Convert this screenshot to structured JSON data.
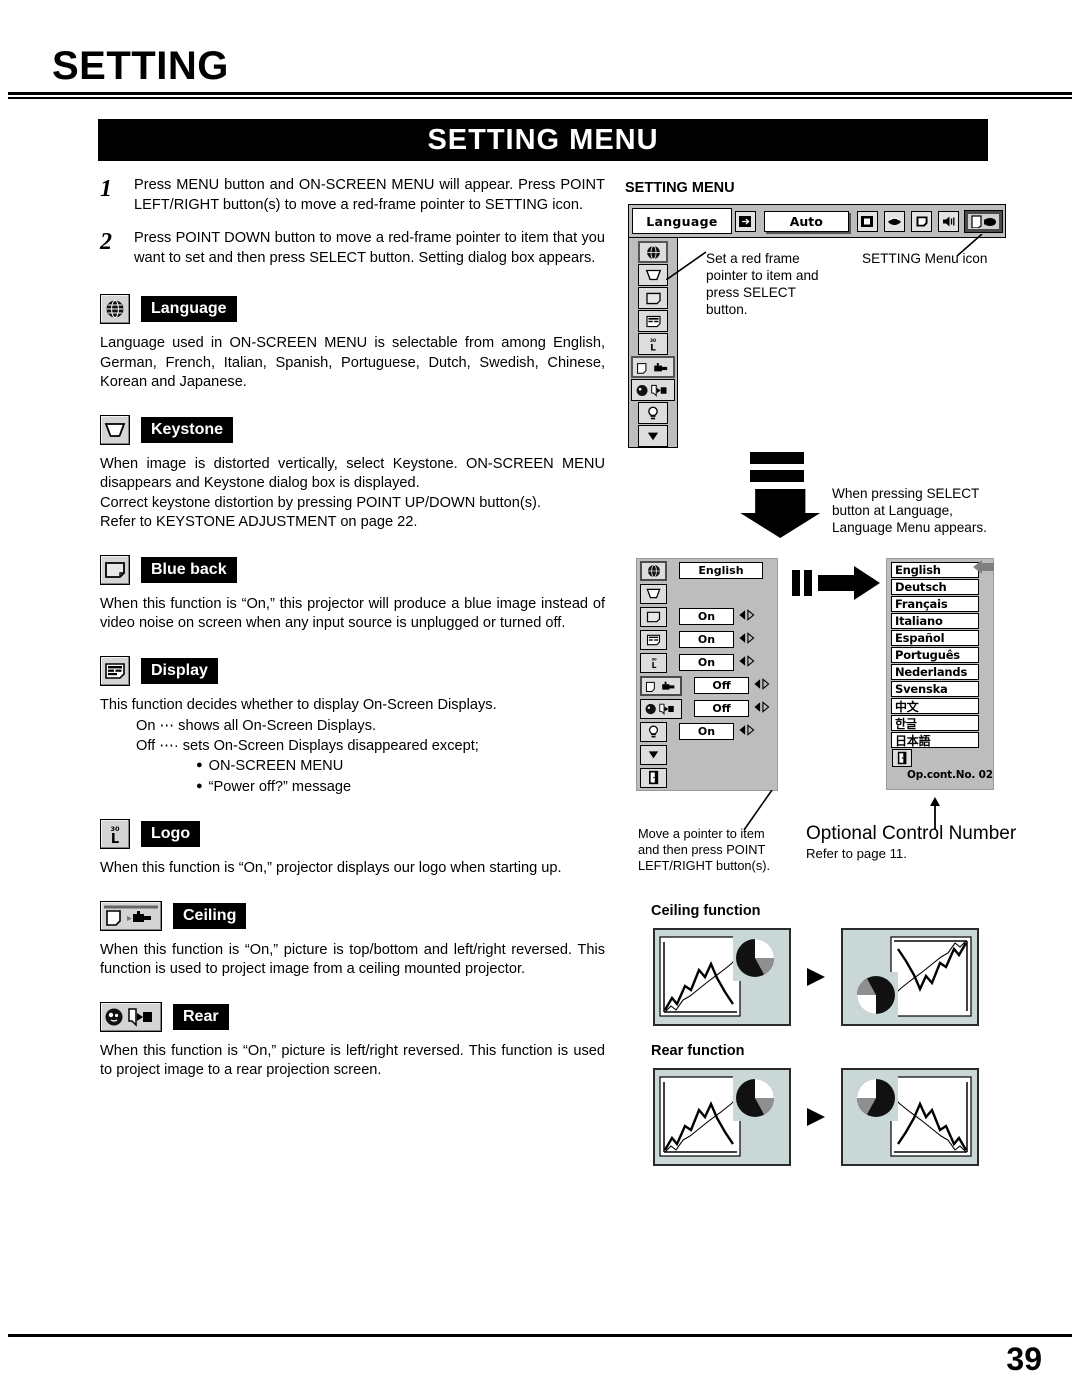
{
  "header": {
    "chapter_title": "SETTING",
    "banner_title": "SETTING MENU"
  },
  "steps": [
    {
      "num": "1",
      "text": "Press MENU button and ON-SCREEN MENU will appear.  Press POINT LEFT/RIGHT button(s) to move a red-frame pointer to SETTING icon."
    },
    {
      "num": "2",
      "text": "Press POINT DOWN button to move a red-frame pointer to item that you want to set and then press SELECT button.  Setting dialog box appears."
    }
  ],
  "sections": [
    {
      "icon": "globe-icon",
      "label": "Language",
      "body": "Language used in ON-SCREEN MENU is selectable from among English, German, French, Italian, Spanish, Portuguese, Dutch, Swedish, Chinese, Korean and Japanese."
    },
    {
      "icon": "keystone-icon",
      "label": "Keystone",
      "body": "When image is distorted vertically, select Keystone.  ON-SCREEN MENU disappears and Keystone dialog box is displayed.",
      "body2": "Correct keystone distortion by pressing POINT UP/DOWN button(s).",
      "body3": "Refer to KEYSTONE ADJUSTMENT on page 22."
    },
    {
      "icon": "blue-back-icon",
      "label": "Blue back",
      "body": "When this function is “On,” this projector will produce a blue image instead of video noise on screen when any input source is unplugged or turned off."
    },
    {
      "icon": "display-icon",
      "label": "Display",
      "body": "This function decides whether to display On-Screen Displays.",
      "list": [
        "On  ⋯ shows all On-Screen Displays.",
        "Off ⋯· sets On-Screen Displays disappeared except;"
      ],
      "sublist": [
        "ON-SCREEN MENU",
        "“Power off?” message"
      ]
    },
    {
      "icon": "logo-icon",
      "label": "Logo",
      "body": "When this function is “On,” projector displays our logo when starting up."
    },
    {
      "icon": "ceiling-icon",
      "label": "Ceiling",
      "body": "When this function is “On,” picture is top/bottom and left/right reversed. This function is used to project image from a ceiling mounted projector."
    },
    {
      "icon": "rear-icon",
      "label": "Rear",
      "body": "When this function is “On,” picture is left/right reversed.  This function is used to project image to a rear projection screen."
    }
  ],
  "right": {
    "menu_title": "SETTING MENU",
    "osd_bar": {
      "language_tab": "Language",
      "auto_button": "Auto",
      "icons": [
        "input-icon",
        "screen-icon",
        "image-icon",
        "pc-adjust-icon",
        "sound-icon",
        "setting-icon"
      ]
    },
    "callout_red_frame": "Set a red frame\npointer to item and\npress SELECT\nbutton.",
    "callout_red_frame_lines": [
      "Set a red frame",
      "pointer to item and",
      "press SELECT",
      "button."
    ],
    "callout_setting_icon": "SETTING Menu icon",
    "callout_select": [
      "When pressing SELECT",
      "button at Language,",
      "Language Menu appears."
    ],
    "dialog": {
      "rows": [
        {
          "icon": "globe-icon",
          "value": "English",
          "wide": true,
          "arrows": false,
          "selected": true
        },
        {
          "icon": "keystone-icon",
          "value": "",
          "arrows": false
        },
        {
          "icon": "blue-back-icon",
          "value": "On",
          "arrows": true
        },
        {
          "icon": "display-icon",
          "value": "On",
          "arrows": true
        },
        {
          "icon": "logo-icon",
          "value": "On",
          "arrows": true
        },
        {
          "icon": "ceiling-icon",
          "value": "Off",
          "arrows": true
        },
        {
          "icon": "rear-icon",
          "value": "Off",
          "arrows": true
        },
        {
          "icon": "lamp-icon",
          "value": "On",
          "arrows": true
        },
        {
          "icon": "scroll-down-icon",
          "value": "",
          "arrows": false
        },
        {
          "icon": "quit-icon",
          "value": "",
          "arrows": false
        }
      ]
    },
    "languages": [
      "English",
      "Deutsch",
      "Français",
      "Italiano",
      "Español",
      "Português",
      "Nederlands",
      "Svenska",
      "中文",
      "한글",
      "日本語"
    ],
    "op_control_number": "Op.cont.No. 02",
    "callout_pointer": [
      "Move a pointer to item",
      "and then press POINT",
      "LEFT/RIGHT button(s)."
    ],
    "optional_control_title": "Optional Control Number",
    "optional_control_sub": "Refer to page 11.",
    "ceiling_fig_title": "Ceiling function",
    "rear_fig_title": "Rear function"
  },
  "footer": {
    "page_number": "39"
  },
  "colors": {
    "osd_gray": "#bdbdbd",
    "chip_gray": "#d4d4d4",
    "screen_teal": "#c9d8d6",
    "black": "#000000"
  }
}
